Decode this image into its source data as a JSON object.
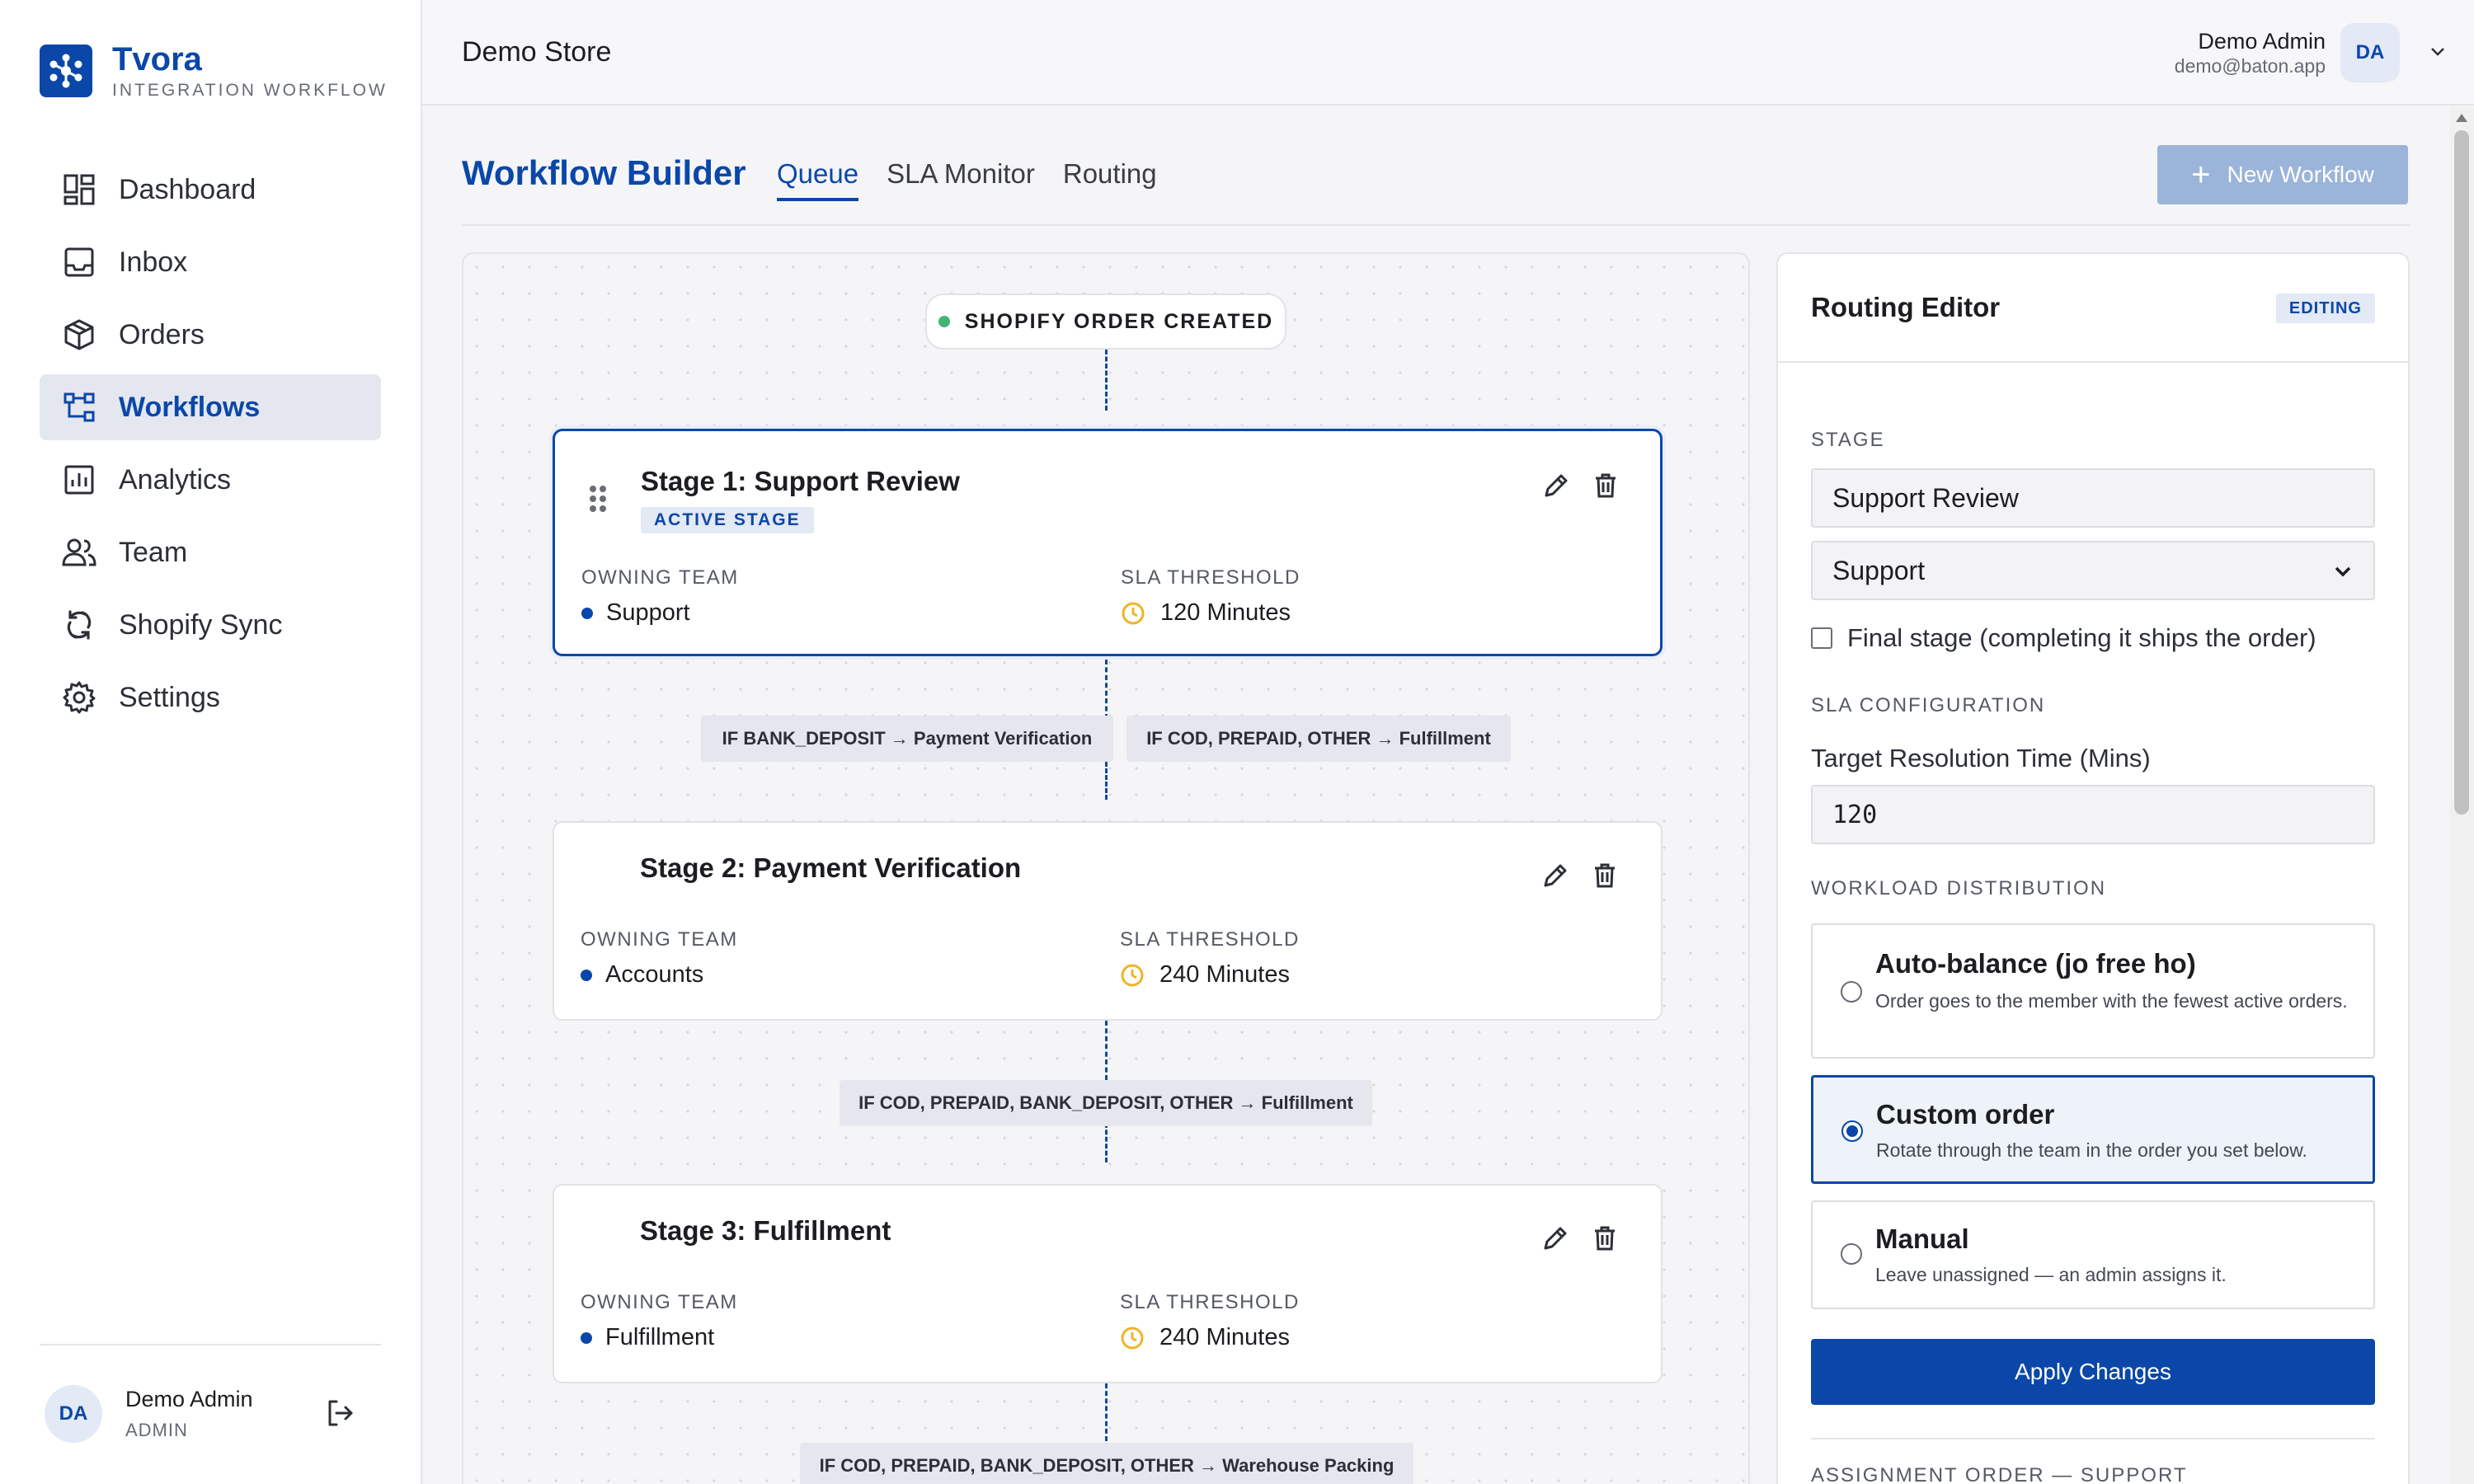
{
  "brand": {
    "name": "Tvora",
    "subtitle": "INTEGRATION WORKFLOW"
  },
  "sidebar": {
    "items": [
      {
        "label": "Dashboard",
        "icon": "dashboard-icon",
        "active": false
      },
      {
        "label": "Inbox",
        "icon": "inbox-icon",
        "active": false
      },
      {
        "label": "Orders",
        "icon": "package-icon",
        "active": false
      },
      {
        "label": "Workflows",
        "icon": "workflow-icon",
        "active": true
      },
      {
        "label": "Analytics",
        "icon": "analytics-icon",
        "active": false
      },
      {
        "label": "Team",
        "icon": "team-icon",
        "active": false
      },
      {
        "label": "Shopify Sync",
        "icon": "sync-icon",
        "active": false
      },
      {
        "label": "Settings",
        "icon": "gear-icon",
        "active": false
      }
    ],
    "footer": {
      "initials": "DA",
      "name": "Demo Admin",
      "role": "ADMIN"
    }
  },
  "header": {
    "store": "Demo Store",
    "user": {
      "name": "Demo Admin",
      "email": "demo@baton.app",
      "initials": "DA"
    }
  },
  "page": {
    "title": "Workflow Builder",
    "tabs": [
      {
        "label": "Queue",
        "active": true
      },
      {
        "label": "SLA Monitor",
        "active": false
      },
      {
        "label": "Routing",
        "active": false
      }
    ],
    "new_workflow_label": "New Workflow"
  },
  "canvas": {
    "trigger": "SHOPIFY ORDER CREATED",
    "owning_team_label": "OWNING TEAM",
    "sla_label": "SLA THRESHOLD",
    "stages": [
      {
        "title": "Stage 1: Support Review",
        "badge": "ACTIVE STAGE",
        "team": "Support",
        "sla": "120 Minutes"
      },
      {
        "title": "Stage 2: Payment Verification",
        "team": "Accounts",
        "sla": "240 Minutes"
      },
      {
        "title": "Stage 3: Fulfillment",
        "team": "Fulfillment",
        "sla": "240 Minutes"
      }
    ],
    "rules": [
      "IF BANK_DEPOSIT → Payment Verification",
      "IF COD, PREPAID, OTHER → Fulfillment",
      "IF COD, PREPAID, BANK_DEPOSIT, OTHER → Fulfillment",
      "IF COD, PREPAID, BANK_DEPOSIT, OTHER → Warehouse Packing"
    ]
  },
  "editor": {
    "title": "Routing Editor",
    "badge": "EDITING",
    "stage_label": "STAGE",
    "stage_name": "Support Review",
    "team_select": "Support",
    "final_stage_label": "Final stage (completing it ships the order)",
    "sla_section": "SLA CONFIGURATION",
    "target_label": "Target Resolution Time (Mins)",
    "target_value": "120",
    "workload_section": "WORKLOAD DISTRIBUTION",
    "options": [
      {
        "title": "Auto-balance (jo free ho)",
        "desc": "Order goes to the member with the fewest active orders.",
        "selected": false
      },
      {
        "title": "Custom order",
        "desc": "Rotate through the team in the order you set below.",
        "selected": true
      },
      {
        "title": "Manual",
        "desc": "Leave unassigned — an admin assigns it.",
        "selected": false
      }
    ],
    "apply_label": "Apply Changes",
    "assignment_label": "ASSIGNMENT ORDER — SUPPORT"
  },
  "colors": {
    "accent": "#0a47a9",
    "trigger_dot": "#44b37a",
    "clock": "#f0b429"
  }
}
